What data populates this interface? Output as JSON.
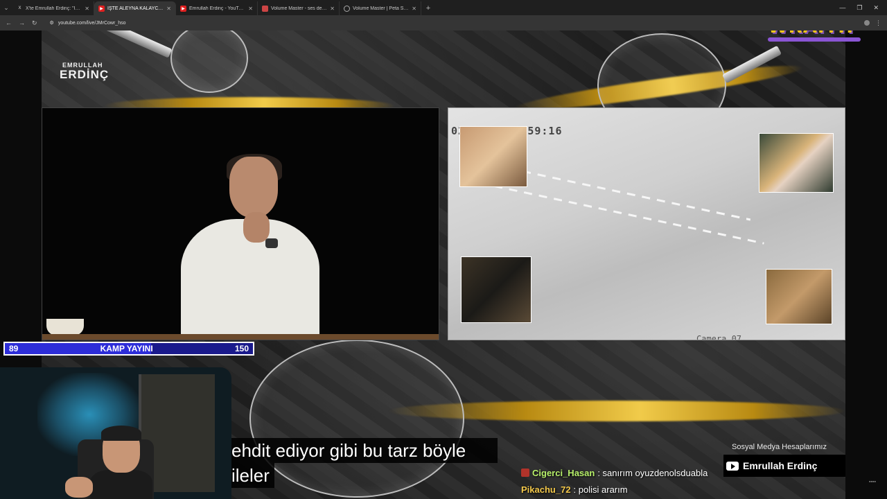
{
  "browser": {
    "tabs": [
      {
        "title": "X'te Emrullah Erdinç: \"İŞTE ALE",
        "icon": "x",
        "active": false
      },
      {
        "title": "İŞTE ALEYNA KALAYCIOĞL",
        "icon": "yt",
        "active": true
      },
      {
        "title": "Emrullah Erdinç - YouTube",
        "icon": "yt",
        "active": false
      },
      {
        "title": "Volume Master - ses denetleyici",
        "icon": "vm",
        "active": false
      },
      {
        "title": "Volume Master | Peta Sittek",
        "icon": "globe",
        "active": false
      }
    ],
    "url": "youtube.com/live/JMrCowr_hso"
  },
  "brand": {
    "line1": "EMRULLAH",
    "line2": "ERDİNÇ"
  },
  "wraith": {
    "text": "WRAITH"
  },
  "cctv": {
    "timestamp": "026 Dec 05 59:16",
    "camera": "Camera 07"
  },
  "kamp_bar": {
    "left_value": "89",
    "label": "KAMP YAYINI",
    "right_value": "150",
    "progress": 0.59
  },
  "subtitle": {
    "line1": "ehdit ediyor gibi bu tarz böyle",
    "line2": "ileler"
  },
  "social": {
    "label": "Sosyal Medya Hesaplarımız",
    "channel": "Emrullah Erdinç"
  },
  "chat": [
    {
      "user": "Cigerci_Hasan",
      "message": ": sanırım oyuzdenolsduabla",
      "user_color": "#b7f06a",
      "has_badge": true
    },
    {
      "user": "Pikachu_72",
      "message": ": polisi ararım",
      "user_color": "#f3c84a",
      "has_badge": false
    }
  ],
  "colors": {
    "accent_gold": "#f3c61a",
    "kamp_blue": "#1a1a8c",
    "wraith_purple": "#8a55d4"
  }
}
